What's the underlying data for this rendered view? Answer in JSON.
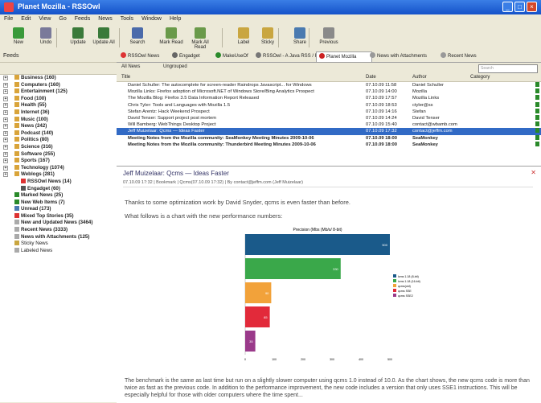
{
  "window": {
    "title": "Planet Mozilla - RSSOwl"
  },
  "menu": [
    "File",
    "Edit",
    "View",
    "Go",
    "Feeds",
    "News",
    "Tools",
    "Window",
    "Help"
  ],
  "toolbar": {
    "buttons": [
      {
        "label": "New",
        "color": "#3a9a3a"
      },
      {
        "label": "Undo",
        "color": "#7a7a9a"
      },
      {
        "label": "Update",
        "color": "#3a7a3a"
      },
      {
        "label": "Update All",
        "color": "#3a7a3a"
      },
      {
        "label": "Search",
        "color": "#4a6aaa"
      },
      {
        "label": "Mark Read",
        "color": "#6a9a4a"
      },
      {
        "label": "Mark All Read",
        "color": "#6a9a4a"
      },
      {
        "label": "Label",
        "color": "#c9a640"
      },
      {
        "label": "Sticky",
        "color": "#c9a640"
      },
      {
        "label": "Share",
        "color": "#4a7ab0"
      },
      {
        "label": "Previous",
        "color": "#8a8a8a"
      }
    ]
  },
  "tabs": [
    {
      "label": "RSSOwl News",
      "color": "#d33"
    },
    {
      "label": "Engadget",
      "color": "#666"
    },
    {
      "label": "MakeUseOf",
      "color": "#2a8a2a"
    },
    {
      "label": "RSSOwl - A Java RSS / R...",
      "color": "#777"
    },
    {
      "label": "Planet Mozilla",
      "color": "#c22",
      "active": true
    },
    {
      "label": "News with Attachments",
      "color": "#999"
    },
    {
      "label": "Recent News",
      "color": "#999"
    }
  ],
  "left": {
    "header": "Feeds",
    "items": [
      {
        "label": "Business (160)",
        "bold": true,
        "color": "#d9a43a"
      },
      {
        "label": "Computers (160)",
        "bold": true,
        "color": "#d9a43a"
      },
      {
        "label": "Entertainment (125)",
        "bold": true,
        "color": "#d9a43a"
      },
      {
        "label": "Food (100)",
        "bold": true,
        "color": "#d9a43a"
      },
      {
        "label": "Health (55)",
        "bold": true,
        "color": "#d9a43a"
      },
      {
        "label": "Internet (36)",
        "bold": true,
        "color": "#d9a43a"
      },
      {
        "label": "Music (100)",
        "bold": true,
        "color": "#d9a43a"
      },
      {
        "label": "News (242)",
        "bold": true,
        "color": "#d9a43a"
      },
      {
        "label": "Podcast (140)",
        "bold": true,
        "color": "#d9a43a"
      },
      {
        "label": "Politics (80)",
        "bold": true,
        "color": "#d9a43a"
      },
      {
        "label": "Science (316)",
        "bold": true,
        "color": "#d9a43a"
      },
      {
        "label": "Software (255)",
        "bold": true,
        "color": "#d9a43a"
      },
      {
        "label": "Sports (167)",
        "bold": true,
        "color": "#d9a43a"
      },
      {
        "label": "Technology (1074)",
        "bold": true,
        "color": "#d9a43a"
      },
      {
        "label": "Weblogs (281)",
        "bold": true,
        "color": "#d9a43a"
      },
      {
        "label": "RSSOwl News (14)",
        "bold": true,
        "color": "#d33",
        "child": true
      },
      {
        "label": "Engadget (60)",
        "bold": true,
        "color": "#555",
        "child": true
      },
      {
        "label": "Marked News (25)",
        "bold": true,
        "color": "#2a8a2a"
      },
      {
        "label": "New Web Items (7)",
        "bold": true,
        "color": "#2a8a2a"
      },
      {
        "label": "Unread (173)",
        "bold": true,
        "color": "#4a7ab0"
      },
      {
        "label": "Mixed Top Stories (35)",
        "bold": true,
        "color": "#d33"
      },
      {
        "label": "New and Updated News (3464)",
        "bold": true,
        "color": "#aaa"
      },
      {
        "label": "Recent News (3333)",
        "bold": true,
        "color": "#aaa"
      },
      {
        "label": "News with Attachments (125)",
        "bold": true,
        "color": "#aaa"
      },
      {
        "label": "Sticky News",
        "bold": false,
        "color": "#c9a640"
      },
      {
        "label": "Labeled News",
        "bold": false,
        "color": "#aaa"
      }
    ]
  },
  "filter": {
    "show": "All News",
    "group": "Ungrouped",
    "search_placeholder": "Search"
  },
  "list": {
    "columns": [
      "Title",
      "Date",
      "Author",
      "Category"
    ],
    "rows": [
      {
        "title": "Daniel Schuller: The autocomplete for screen-reader Raindrops Javascript... for Windows",
        "date": "07.10.09 11:58",
        "author": "Daniel Schuller"
      },
      {
        "title": "Mozilla Links: Firefox adoption of Microsoft.NET of Windows Store/Bing Analytics Prospect",
        "date": "07.10.09 14:00",
        "author": "Mozilla"
      },
      {
        "title": "The Mozilla Blog: Firefox 3.5 Data Information Report Released",
        "date": "07.10.09 17:57",
        "author": "Mozilla Links"
      },
      {
        "title": "Chris Tyler: Tools and Languages with Mozilla 1.5",
        "date": "07.10.09 18:53",
        "author": "ctyler@ss"
      },
      {
        "title": "Stefan Arentz: Hack Weekend Prospect",
        "date": "07.10.09 14:16",
        "author": "Stefan"
      },
      {
        "title": "David Tenser: Support project post mortem",
        "date": "07.10.09 14:24",
        "author": "David Tenser"
      },
      {
        "title": "Will Bamberg: WebThings Desktop Project",
        "date": "07.10.09 15:40",
        "author": "contact@wbamb.com"
      },
      {
        "title": "Jeff Muizelaar: Qcms — Ideas Faster",
        "date": "07.10.09 17:32",
        "author": "contact@jeffm.com",
        "selected": true
      },
      {
        "title": "Meeting Notes from the Mozilla community: SeaMonkey Meeting Minutes 2009-10-06",
        "date": "07.10.09 18:00",
        "author": "SeaMonkey",
        "unread": true
      },
      {
        "title": "Meeting Notes from the Mozilla community: Thunderbird Meeting Minutes 2009-10-06",
        "date": "07.10.09 18:00",
        "author": "SeaMonkey",
        "unread": true
      }
    ]
  },
  "reader": {
    "title": "Jeff Muizelaar: Qcms — Ideas Faster",
    "meta": "07.10.09 17:32  |  Bookmark  |  Qcms(07.10.09 17:32)  |  By contact@jeffm.com (Jeff Muizelaar)",
    "p1": "Thanks to some optimization work by David Snyder, qcms is even faster than before.",
    "p2": "What follows is a chart with the new performance numbers:",
    "p3": "The benchmark is the same as last time but run on a slightly slower computer using qcms 1.0 instead of 10.0. As the chart shows, the new qcms code is more than twice as fast as the previous code. In addition to the performance improvement, the new code includes a version that only uses SSE1 instructions. This will be especially helpful for those with older computers where the time spent..."
  },
  "chart_data": {
    "type": "bar",
    "orientation": "horizontal",
    "title": "Precision (Mbs (Mb/s/ 8-bit)",
    "categories": [
      "lcms 1.18 (8-bit)",
      "lcms 1.18 (16-bit)",
      "qcms(old)",
      "qcms SSE",
      "qcms SSE2"
    ],
    "values": [
      500,
      330,
      90,
      85,
      35
    ],
    "colors": [
      "#1a5a8a",
      "#3aa84a",
      "#f2a23a",
      "#e22a3a",
      "#9a3a8a"
    ],
    "xlim": [
      0,
      500
    ],
    "legend_position": "right"
  }
}
